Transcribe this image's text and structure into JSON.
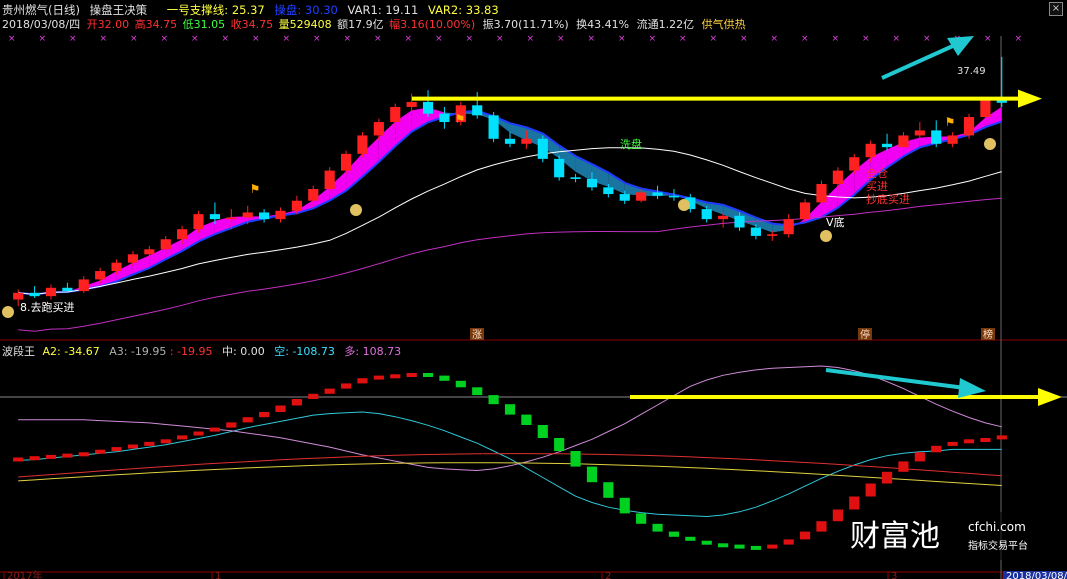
{
  "header": {
    "stock_name": "贵州燃气(日线)",
    "indicator_name": "操盘王决策",
    "support_label": "一号支撑线: 25.37",
    "hidden_label": "操盘: 30.30",
    "var1": "VAR1: 19.11",
    "var2": "VAR2: 33.83"
  },
  "quote": {
    "date": "2018/03/08/四",
    "open": "开32.00",
    "high": "高34.75",
    "low": "低31.05",
    "close": "收34.75",
    "volume": "量529408",
    "amount": "额17.9亿",
    "change": "幅3.16(10.00%)",
    "amplitude": "振3.70(11.71%)",
    "turnover": "换43.41%",
    "float": "流通1.22亿",
    "tag": "供气供热"
  },
  "sub_header": {
    "name": "波段王",
    "a2": "A2: -34.67",
    "a3": "A3: -19.95",
    "b": ": -19.95",
    "mid": "中: 0.00",
    "short": "空: -108.73",
    "long": "多: 108.73"
  },
  "labels": {
    "wash": "洗盘",
    "full": "全仓",
    "buy": "买进",
    "bottom_buy": "抄底买进",
    "v_bottom": "V底",
    "buy2": "8.去跑买进",
    "price_top": "37.49",
    "zhang": "涨",
    "ting": "停",
    "bang": "榜"
  },
  "x_axis": {
    "ticks": [
      "2017年",
      "1",
      "2",
      "3",
      "2018/03/08/"
    ]
  },
  "watermark": {
    "brand": "财富池",
    "site": "cfchi.com",
    "slogan": "指标交易平台"
  },
  "colors": {
    "up": "#ff2020",
    "down": "#00e0ff",
    "band": "#ff00ff",
    "ma_blue": "#1f3cff",
    "ma_white": "#ffffff",
    "ma_purple": "#c030c0",
    "arrow_yellow": "#ffff00",
    "arrow_cyan": "#20c8d0",
    "green_bar": "#00d020",
    "red_bar": "#e01010"
  },
  "chart_data": {
    "type": "candlestick",
    "main": {
      "candles": [
        {
          "o": 23.0,
          "h": 23.6,
          "l": 22.6,
          "c": 23.4
        },
        {
          "o": 23.4,
          "h": 23.8,
          "l": 23.1,
          "c": 23.2
        },
        {
          "o": 23.2,
          "h": 23.9,
          "l": 23.0,
          "c": 23.7
        },
        {
          "o": 23.7,
          "h": 24.0,
          "l": 23.4,
          "c": 23.5
        },
        {
          "o": 23.5,
          "h": 24.4,
          "l": 23.4,
          "c": 24.2
        },
        {
          "o": 24.2,
          "h": 24.9,
          "l": 24.0,
          "c": 24.7
        },
        {
          "o": 24.7,
          "h": 25.4,
          "l": 24.5,
          "c": 25.2
        },
        {
          "o": 25.2,
          "h": 25.9,
          "l": 25.0,
          "c": 25.7
        },
        {
          "o": 25.7,
          "h": 26.2,
          "l": 25.4,
          "c": 26.0
        },
        {
          "o": 26.0,
          "h": 26.8,
          "l": 25.8,
          "c": 26.6
        },
        {
          "o": 26.6,
          "h": 27.4,
          "l": 26.3,
          "c": 27.2
        },
        {
          "o": 27.2,
          "h": 28.3,
          "l": 27.0,
          "c": 28.1
        },
        {
          "o": 28.1,
          "h": 28.8,
          "l": 27.5,
          "c": 27.8
        },
        {
          "o": 27.8,
          "h": 28.4,
          "l": 27.2,
          "c": 27.9
        },
        {
          "o": 27.9,
          "h": 28.6,
          "l": 27.5,
          "c": 28.2
        },
        {
          "o": 28.2,
          "h": 28.4,
          "l": 27.6,
          "c": 27.8
        },
        {
          "o": 27.8,
          "h": 28.5,
          "l": 27.6,
          "c": 28.3
        },
        {
          "o": 28.3,
          "h": 29.2,
          "l": 28.1,
          "c": 28.9
        },
        {
          "o": 28.9,
          "h": 29.8,
          "l": 28.6,
          "c": 29.6
        },
        {
          "o": 29.6,
          "h": 30.9,
          "l": 29.4,
          "c": 30.7
        },
        {
          "o": 30.7,
          "h": 31.9,
          "l": 30.5,
          "c": 31.7
        },
        {
          "o": 31.7,
          "h": 33.0,
          "l": 31.5,
          "c": 32.8
        },
        {
          "o": 32.8,
          "h": 33.8,
          "l": 32.5,
          "c": 33.6
        },
        {
          "o": 33.6,
          "h": 34.7,
          "l": 33.2,
          "c": 34.5
        },
        {
          "o": 34.5,
          "h": 35.3,
          "l": 34.2,
          "c": 34.8
        },
        {
          "o": 34.8,
          "h": 35.5,
          "l": 33.9,
          "c": 34.1
        },
        {
          "o": 34.1,
          "h": 34.5,
          "l": 33.2,
          "c": 33.6
        },
        {
          "o": 33.6,
          "h": 34.8,
          "l": 33.4,
          "c": 34.6
        },
        {
          "o": 34.6,
          "h": 35.4,
          "l": 33.8,
          "c": 34.0
        },
        {
          "o": 34.0,
          "h": 34.2,
          "l": 32.4,
          "c": 32.6
        },
        {
          "o": 32.6,
          "h": 33.0,
          "l": 32.1,
          "c": 32.3
        },
        {
          "o": 32.3,
          "h": 33.1,
          "l": 32.0,
          "c": 32.6
        },
        {
          "o": 32.6,
          "h": 32.8,
          "l": 31.2,
          "c": 31.4
        },
        {
          "o": 31.4,
          "h": 31.6,
          "l": 30.1,
          "c": 30.3
        },
        {
          "o": 30.3,
          "h": 30.5,
          "l": 30.0,
          "c": 30.2
        },
        {
          "o": 30.2,
          "h": 30.6,
          "l": 29.5,
          "c": 29.7
        },
        {
          "o": 29.7,
          "h": 29.9,
          "l": 29.1,
          "c": 29.3
        },
        {
          "o": 29.3,
          "h": 29.5,
          "l": 28.7,
          "c": 28.9
        },
        {
          "o": 28.9,
          "h": 29.6,
          "l": 28.8,
          "c": 29.4
        },
        {
          "o": 29.4,
          "h": 29.8,
          "l": 29.0,
          "c": 29.2
        },
        {
          "o": 29.2,
          "h": 29.6,
          "l": 28.9,
          "c": 29.1
        },
        {
          "o": 29.1,
          "h": 29.3,
          "l": 28.2,
          "c": 28.4
        },
        {
          "o": 28.4,
          "h": 28.6,
          "l": 27.6,
          "c": 27.8
        },
        {
          "o": 27.8,
          "h": 28.2,
          "l": 27.3,
          "c": 28.0
        },
        {
          "o": 28.0,
          "h": 28.2,
          "l": 27.1,
          "c": 27.3
        },
        {
          "o": 27.3,
          "h": 27.5,
          "l": 26.6,
          "c": 26.8
        },
        {
          "o": 26.8,
          "h": 27.1,
          "l": 26.5,
          "c": 26.9
        },
        {
          "o": 26.9,
          "h": 28.1,
          "l": 26.7,
          "c": 27.8
        },
        {
          "o": 27.8,
          "h": 29.0,
          "l": 27.6,
          "c": 28.8
        },
        {
          "o": 28.8,
          "h": 30.1,
          "l": 28.6,
          "c": 29.9
        },
        {
          "o": 29.9,
          "h": 30.9,
          "l": 29.6,
          "c": 30.7
        },
        {
          "o": 30.7,
          "h": 31.7,
          "l": 30.5,
          "c": 31.5
        },
        {
          "o": 31.5,
          "h": 32.5,
          "l": 31.2,
          "c": 32.3
        },
        {
          "o": 32.3,
          "h": 32.9,
          "l": 31.9,
          "c": 32.1
        },
        {
          "o": 32.1,
          "h": 33.0,
          "l": 31.9,
          "c": 32.8
        },
        {
          "o": 32.8,
          "h": 33.6,
          "l": 32.6,
          "c": 33.1
        },
        {
          "o": 33.1,
          "h": 33.7,
          "l": 32.1,
          "c": 32.3
        },
        {
          "o": 32.3,
          "h": 33.0,
          "l": 32.1,
          "c": 32.8
        },
        {
          "o": 32.8,
          "h": 34.1,
          "l": 32.6,
          "c": 33.9
        },
        {
          "o": 33.9,
          "h": 35.1,
          "l": 33.6,
          "c": 34.9
        },
        {
          "o": 34.9,
          "h": 37.49,
          "l": 34.5,
          "c": 34.75
        }
      ],
      "price_range": [
        21.0,
        38.5
      ],
      "yellow_line_price": 35.0
    },
    "sub": {
      "bars": [
        -15,
        -14,
        -13,
        -12,
        -11,
        -9,
        -7,
        -5,
        -3,
        -1,
        2,
        5,
        8,
        12,
        16,
        20,
        25,
        30,
        34,
        38,
        42,
        46,
        48,
        49,
        50,
        48,
        44,
        39,
        33,
        26,
        18,
        10,
        0,
        -10,
        -22,
        -34,
        -46,
        -58,
        -66,
        -72,
        -76,
        -79,
        -81,
        -82,
        -83,
        -84,
        -82,
        -78,
        -72,
        -64,
        -55,
        -45,
        -35,
        -26,
        -18,
        -11,
        -6,
        -3,
        -1,
        0,
        2
      ],
      "value_range": [
        -100,
        60
      ]
    }
  }
}
